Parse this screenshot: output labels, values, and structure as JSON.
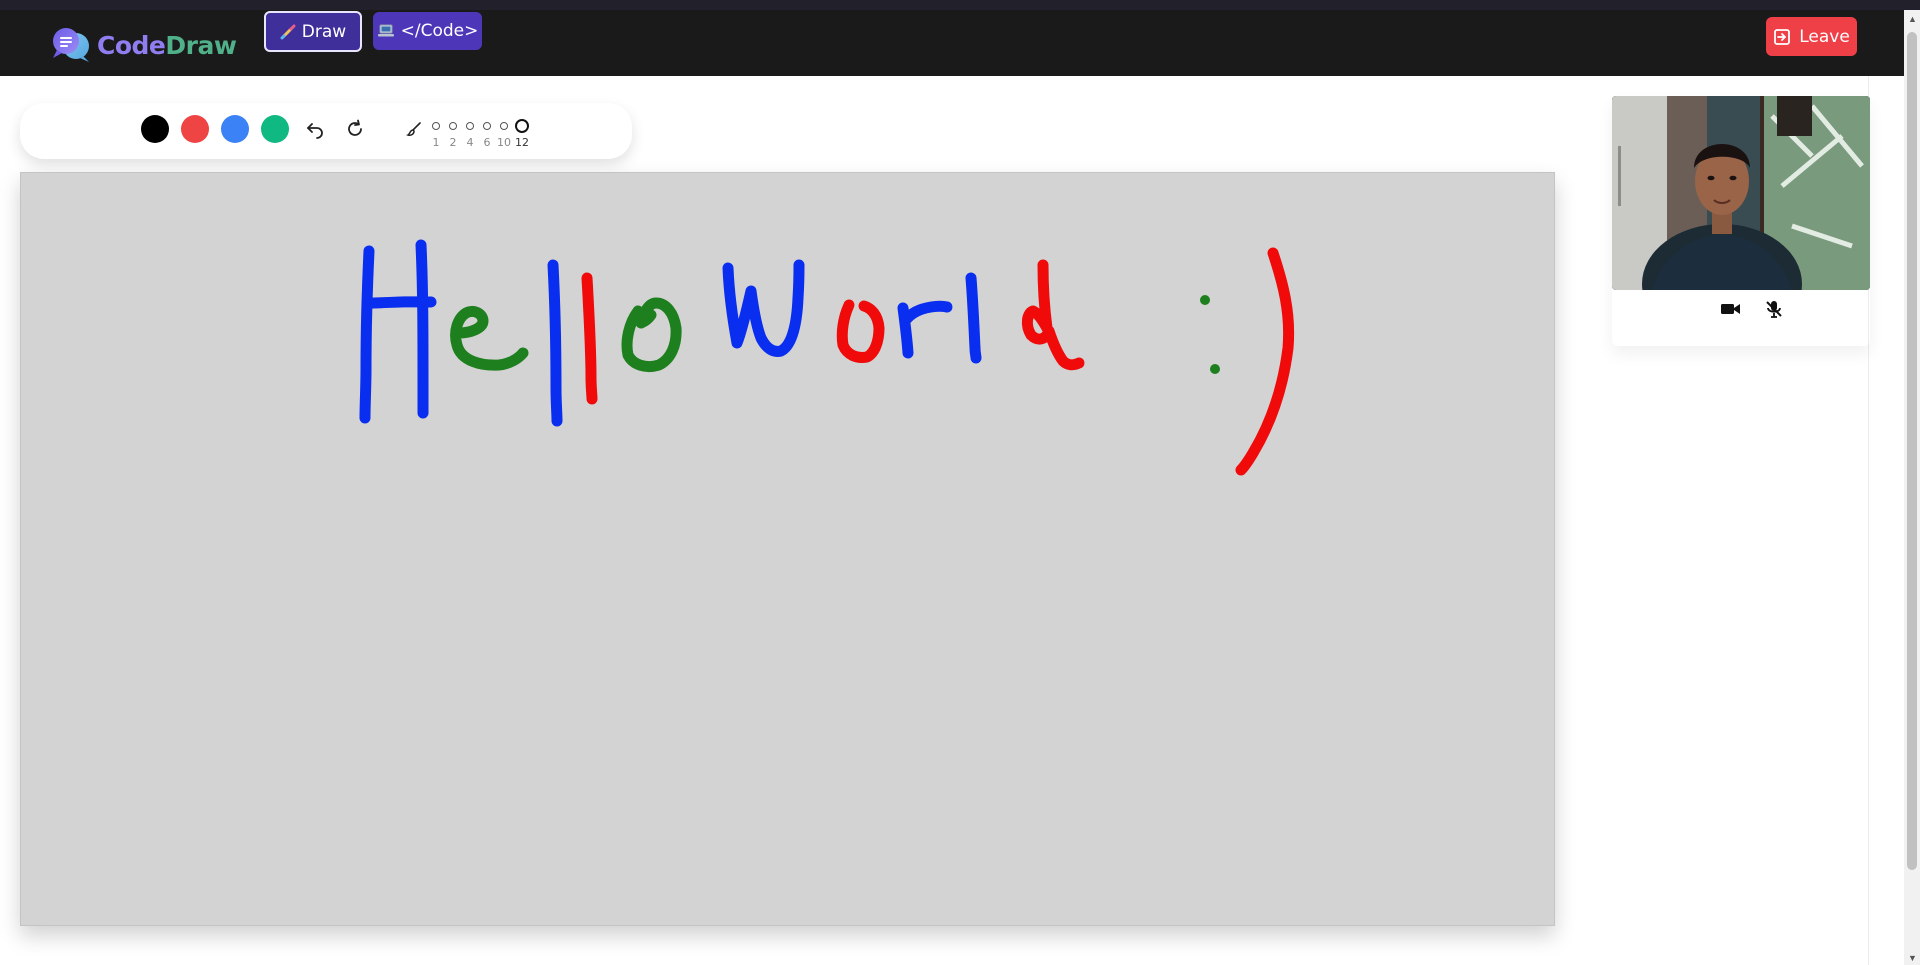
{
  "app": {
    "logo_part1": "Code",
    "logo_part2": "Draw",
    "logo_icon": "chat-bubbles-icon",
    "draw_label": "Draw",
    "draw_icon": "paintbrush-icon",
    "code_label": "</Code>",
    "code_icon": "laptop-icon",
    "leave_label": "Leave",
    "leave_icon": "logout-icon"
  },
  "toolbar": {
    "colors": [
      "#000000",
      "#ef4444",
      "#3b82f6",
      "#10b981"
    ],
    "undo_icon": "undo-icon",
    "redo_icon": "redo-icon",
    "brush_icon": "brush-icon",
    "sizes": [
      "1",
      "2",
      "4",
      "6",
      "10",
      "12"
    ],
    "selected_size": "12"
  },
  "canvas": {
    "background": "#d3d3d3",
    "drawing_text": "Hello World :)"
  },
  "video": {
    "camera_icon": "camera-icon",
    "mic_icon": "mic-off-icon"
  }
}
